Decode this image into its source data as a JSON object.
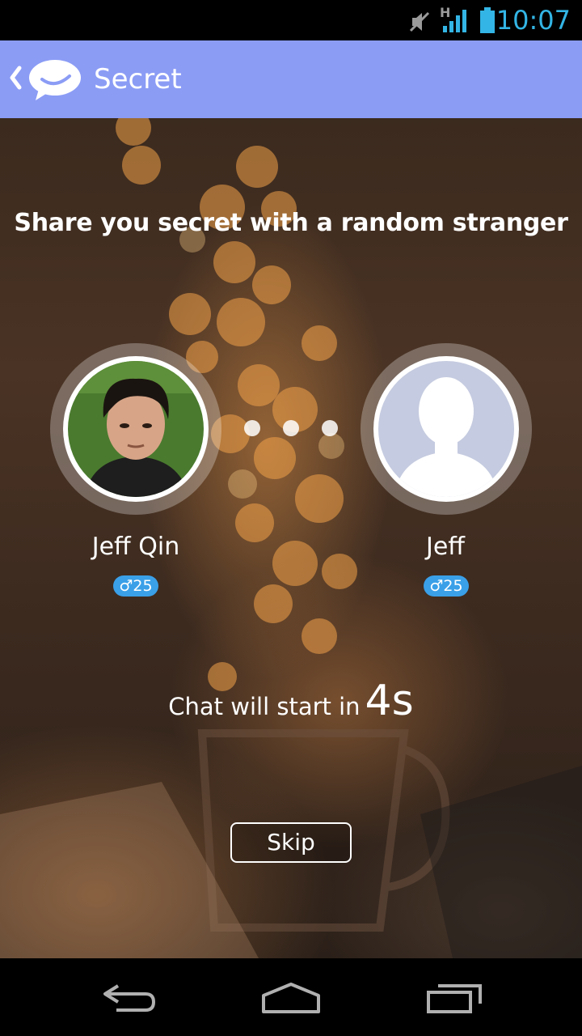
{
  "status_bar": {
    "time": "10:07",
    "network_type": "H",
    "icons": [
      "mute-icon",
      "signal-icon",
      "battery-icon"
    ],
    "accent_color": "#33b5e5"
  },
  "action_bar": {
    "title": "Secret",
    "background_color": "#8b9cf5"
  },
  "main": {
    "tagline": "Share you secret with a random stranger",
    "users": [
      {
        "name": "Jeff Qin",
        "gender_symbol": "♂",
        "age": "25",
        "avatar": "photo"
      },
      {
        "name": "Jeff",
        "gender_symbol": "♂",
        "age": "25",
        "avatar": "default-silhouette"
      }
    ],
    "countdown_label": "Chat will start in",
    "countdown_value": "4s",
    "skip_label": "Skip",
    "badge_color": "#3aa0e8"
  },
  "nav_bar": {
    "icons": [
      "back-icon",
      "home-icon",
      "recent-apps-icon"
    ]
  }
}
